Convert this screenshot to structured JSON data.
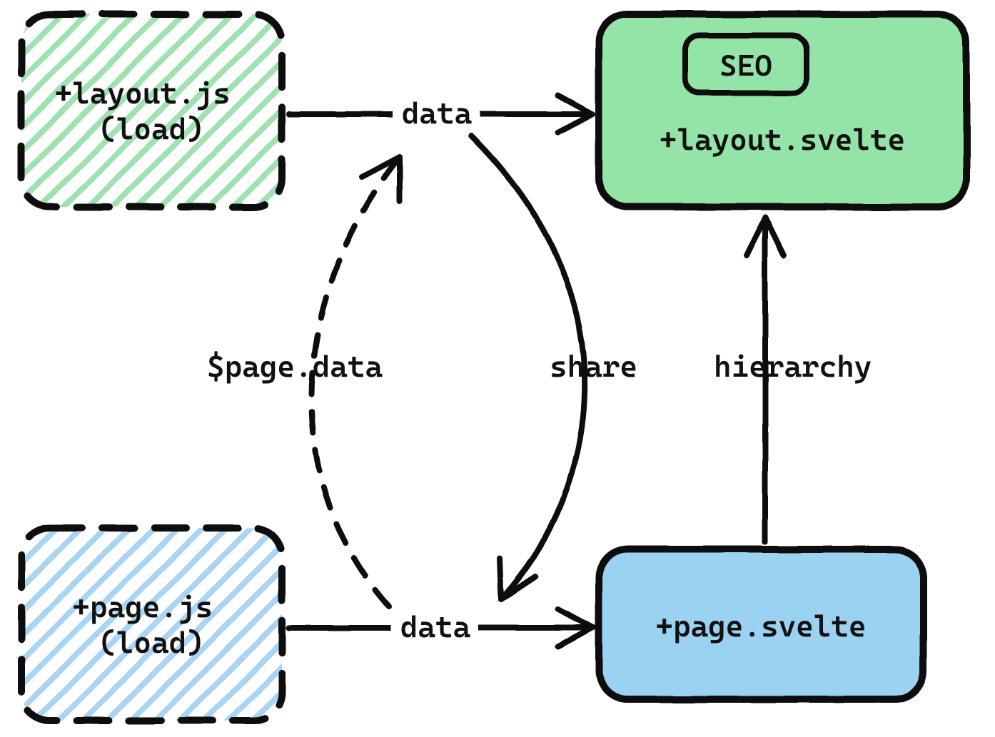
{
  "nodes": {
    "layout_js": {
      "label_line1": "+layout.js",
      "label_line2": "(load)"
    },
    "page_js": {
      "label_line1": "+page.js",
      "label_line2": "(load)"
    },
    "layout_svelte": {
      "label": "+layout.svelte",
      "badge": "SEO"
    },
    "page_svelte": {
      "label": "+page.svelte"
    }
  },
  "edges": {
    "layout_data": {
      "label": "data"
    },
    "page_data_arrow": {
      "label": "data"
    },
    "share": {
      "label": "share"
    },
    "page_data_dashed": {
      "label": "$page.data"
    },
    "hierarchy": {
      "label": "hierarchy"
    }
  },
  "colors": {
    "green_fill": "#94e4a8",
    "green_hatch": "#8fd89d",
    "blue_fill": "#9bd2f2",
    "blue_hatch": "#a6cef0",
    "stroke": "#111111"
  }
}
